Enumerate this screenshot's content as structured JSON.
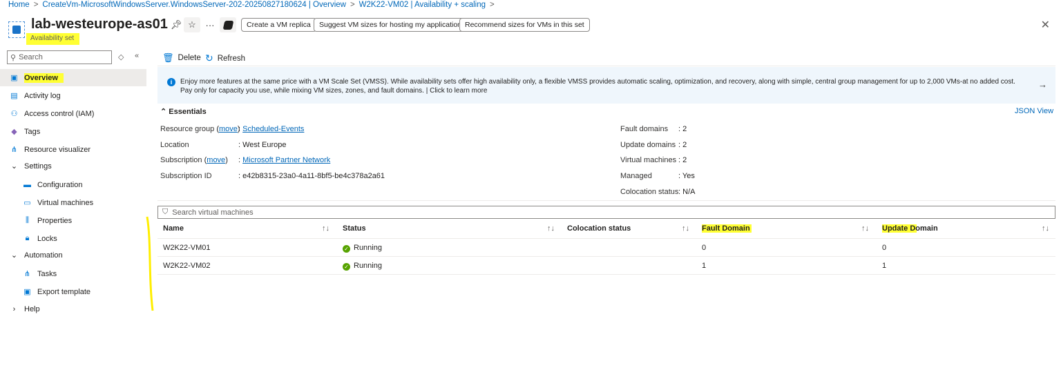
{
  "breadcrumb": [
    "Home",
    "CreateVm-MicrosoftWindowsServer.WindowsServer-202-20250827180624 | Overview",
    "W2K22-VM02 | Availability + scaling"
  ],
  "header": {
    "title": "lab-westeurope-as01",
    "subtitle": "Availability set",
    "buttons": [
      "Create a VM replica",
      "Suggest VM sizes for hosting my application",
      "Recommend sizes for VMs in this set"
    ]
  },
  "sidebar": {
    "search_placeholder": "Search",
    "items": [
      {
        "label": "Overview"
      },
      {
        "label": "Activity log"
      },
      {
        "label": "Access control (IAM)"
      },
      {
        "label": "Tags"
      },
      {
        "label": "Resource visualizer"
      },
      {
        "label": "Settings"
      },
      {
        "label": "Configuration"
      },
      {
        "label": "Virtual machines"
      },
      {
        "label": "Properties"
      },
      {
        "label": "Locks"
      },
      {
        "label": "Automation"
      },
      {
        "label": "Tasks"
      },
      {
        "label": "Export template"
      },
      {
        "label": "Help"
      }
    ]
  },
  "toolbar": {
    "delete": "Delete",
    "refresh": "Refresh"
  },
  "banner": {
    "text": "Enjoy more features at the same price with a VM Scale Set (VMSS). While availability sets offer high availability only, a flexible VMSS provides automatic scaling, optimization, and recovery, along with simple, central group management for up to 2,000 VMs-at no added cost. Pay only for capacity you use, while mixing VM sizes, zones, and fault domains. | Click to learn more"
  },
  "essentials": {
    "title": "Essentials",
    "json_view": "JSON View",
    "move": "move",
    "left": [
      {
        "label": "Resource group",
        "value": "Scheduled-Events"
      },
      {
        "label": "Location",
        "value": "West Europe"
      },
      {
        "label": "Subscription",
        "value": "Microsoft Partner Network"
      },
      {
        "label": "Subscription ID",
        "value": "e42b8315-23a0-4a11-8bf5-be4c378a2a61"
      }
    ],
    "right": [
      {
        "label": "Fault domains",
        "value": "2"
      },
      {
        "label": "Update domains",
        "value": "2"
      },
      {
        "label": "Virtual machines",
        "value": "2"
      },
      {
        "label": "Managed",
        "value": "Yes"
      },
      {
        "label": "Colocation status",
        "value": "N/A"
      }
    ]
  },
  "vms": {
    "search_placeholder": "Search virtual machines",
    "columns": [
      "Name",
      "Status",
      "Colocation status",
      "Fault Domain",
      "Update Domain"
    ],
    "rows": [
      {
        "name": "W2K22-VM01",
        "status": "Running",
        "colocation": "",
        "fault": "0",
        "update": "0"
      },
      {
        "name": "W2K22-VM02",
        "status": "Running",
        "colocation": "",
        "fault": "1",
        "update": "1"
      }
    ]
  },
  "colors": {
    "accent": "#0078d4",
    "highlight": "#ffff33",
    "running": "#57a300"
  }
}
